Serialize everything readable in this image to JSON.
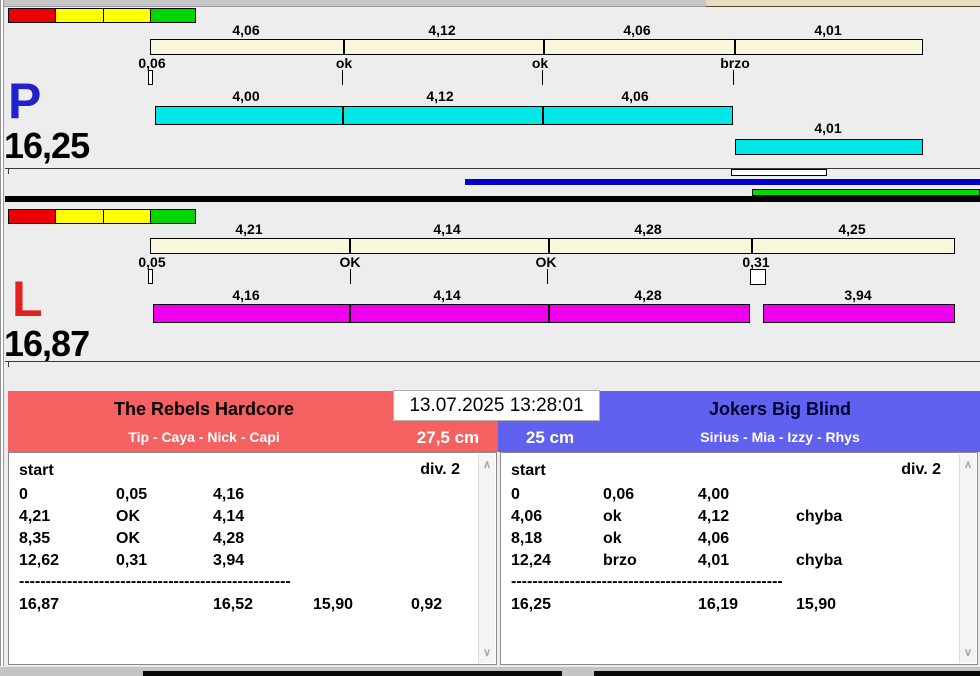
{
  "colors": {
    "background": "#EDEDED",
    "ref_bar": "#F9F7DA",
    "lane_p_bar": "#00E7E7",
    "lane_l_bar": "#EE00EE",
    "progress_blue": "#0000C8",
    "progress_green": "#00DC00",
    "lane_p_letter": "#2222CC",
    "lane_l_letter": "#E22222",
    "team_left_bg": "#F56161",
    "team_right_bg": "#6161F0",
    "traffic_lights": [
      "#EE0000",
      "#FFFF00",
      "#FFFF00",
      "#00D500"
    ]
  },
  "lane_p": {
    "letter": "P",
    "total": "16,25",
    "ref_segments": [
      "4,06",
      "4,12",
      "4,06",
      "4,01"
    ],
    "marks": [
      "0,06",
      "ok",
      "ok",
      "brzo"
    ],
    "run_segments": [
      "4,00",
      "4,12",
      "4,06"
    ],
    "run_extra": "4,01"
  },
  "lane_l": {
    "letter": "L",
    "total": "16,87",
    "ref_segments": [
      "4,21",
      "4,14",
      "4,28",
      "4,25"
    ],
    "marks": [
      "0,05",
      "OK",
      "OK",
      "0,31"
    ],
    "run_segments": [
      "4,16",
      "4,14",
      "4,28"
    ],
    "run_extra": "3,94"
  },
  "scoreboard": {
    "timestamp": "13.07.2025 13:28:01",
    "left": {
      "name": "The Rebels Hardcore",
      "members": "Tip - Caya - Nick - Capi",
      "height": "27,5 cm",
      "start_label": "start",
      "division": "div. 2",
      "rows": [
        [
          "0",
          "0,05",
          "4,16",
          ""
        ],
        [
          "4,21",
          "OK",
          "4,14",
          ""
        ],
        [
          "8,35",
          "OK",
          "4,28",
          ""
        ],
        [
          "12,62",
          "0,31",
          "3,94",
          ""
        ]
      ],
      "divider": "----------------------------------------------------------------",
      "totals": [
        "16,87",
        "16,52",
        "15,90",
        "0,92"
      ]
    },
    "right": {
      "name": "Jokers Big Blind",
      "members": "Sirius - Mia - Izzy - Rhys",
      "height": "25 cm",
      "start_label": "start",
      "division": "div. 2",
      "rows": [
        [
          "0",
          "0,06",
          "4,00",
          ""
        ],
        [
          "4,06",
          "ok",
          "4,12",
          "chyba"
        ],
        [
          "8,18",
          "ok",
          "4,06",
          ""
        ],
        [
          "12,24",
          "brzo",
          "4,01",
          "chyba"
        ]
      ],
      "divider": "----------------------------------------------------------------",
      "totals": [
        "16,25",
        "16,19",
        "15,90",
        ""
      ]
    }
  },
  "icons": {
    "scroll_up": "∧",
    "scroll_down": "∨"
  }
}
